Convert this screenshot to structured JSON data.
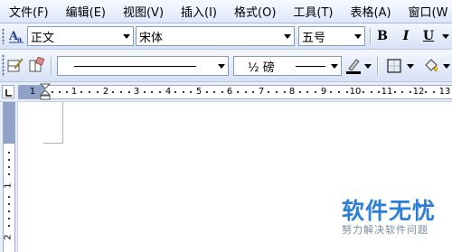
{
  "menu": {
    "items": [
      "文件(F)",
      "编辑(E)",
      "视图(V)",
      "插入(I)",
      "格式(O)",
      "工具(T)",
      "表格(A)",
      "窗口(W"
    ]
  },
  "format_toolbar": {
    "style_value": "正文",
    "font_value": "宋体",
    "size_value": "五号",
    "bold_label": "B",
    "italic_label": "I",
    "underline_label": "U"
  },
  "drawing_toolbar": {
    "line_weight_label": "½ 磅"
  },
  "ruler": {
    "labels": [
      "1",
      "1",
      "2",
      "3",
      "4",
      "5",
      "6",
      "7",
      "8",
      "9",
      "10",
      "11",
      "12",
      "13"
    ],
    "vertical_labels": [
      "1",
      "2"
    ]
  },
  "watermark": {
    "title": "软件无忧",
    "subtitle": "努力解决软件问题"
  },
  "colors": {
    "accent_blue": "#2b7fd6",
    "pen_underline": "#000000",
    "fill_bucket": "#ffd200"
  }
}
